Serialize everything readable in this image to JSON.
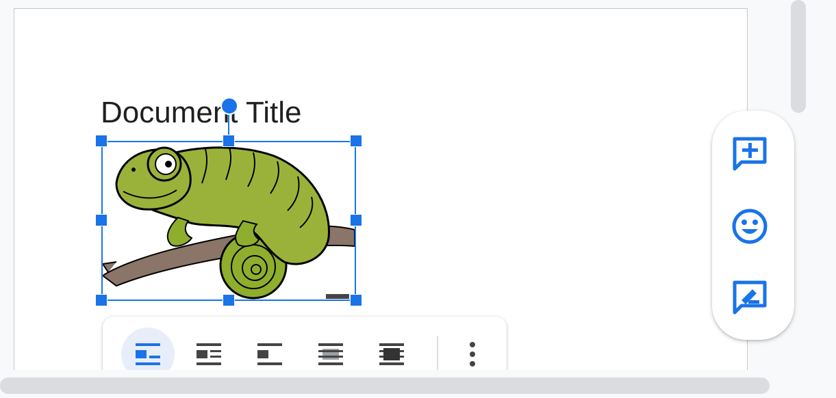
{
  "document": {
    "title": "Document Title"
  },
  "image": {
    "subject": "chameleon-clipart"
  },
  "side_panel": {
    "buttons": [
      {
        "icon": "add-comment-icon"
      },
      {
        "icon": "emoji-reaction-icon"
      },
      {
        "icon": "suggest-edits-icon"
      }
    ]
  },
  "image_toolbar": {
    "options": [
      {
        "icon": "wrap-inline-icon",
        "active": true
      },
      {
        "icon": "wrap-text-icon",
        "active": false
      },
      {
        "icon": "break-text-icon",
        "active": false
      },
      {
        "icon": "behind-text-icon",
        "active": false
      },
      {
        "icon": "in-front-of-text-icon",
        "active": false
      }
    ],
    "more_icon": "more-vert-icon"
  },
  "colors": {
    "accent": "#1a73e8",
    "page": "#ffffff",
    "background": "#f8f9fa",
    "scrollbar": "#dadce0"
  }
}
